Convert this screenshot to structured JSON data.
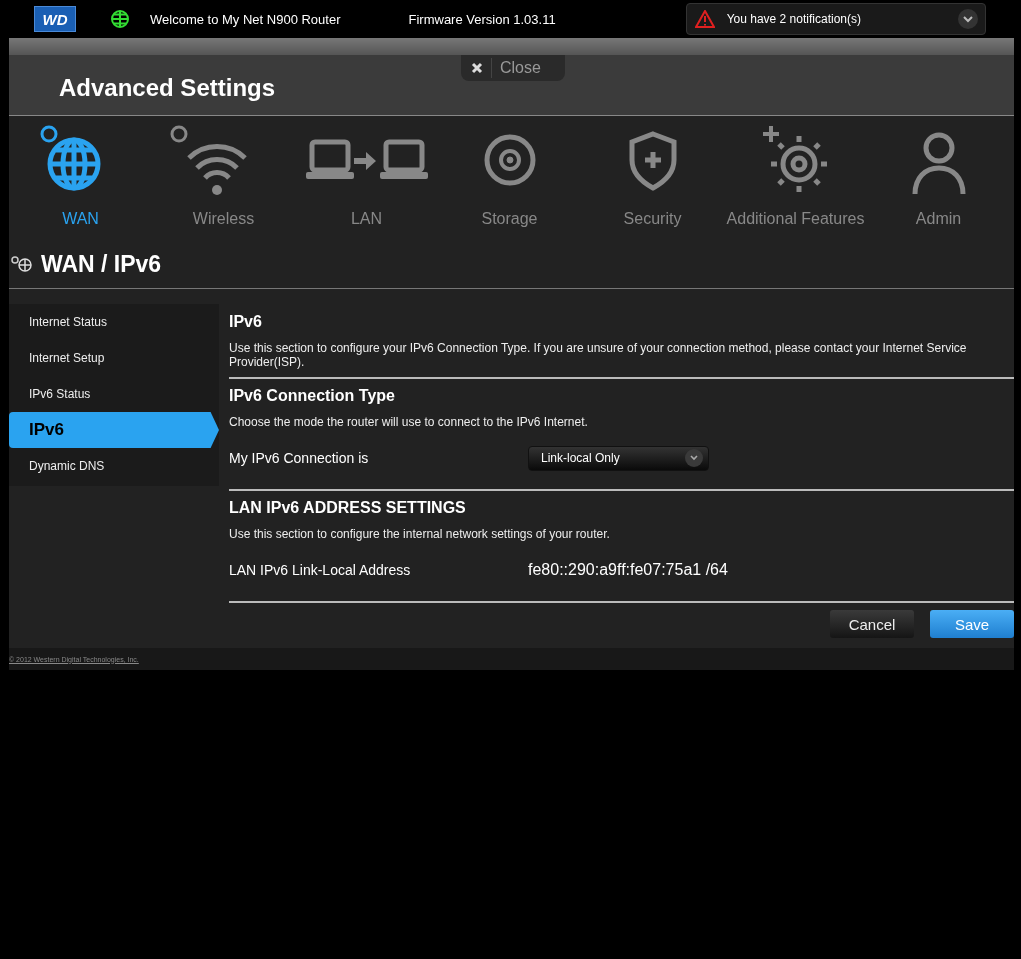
{
  "top_bar": {
    "logo": "WD",
    "welcome": "Welcome to My Net N900 Router",
    "firmware": "Firmware Version 1.03.11",
    "notification": "You have 2 notification(s)"
  },
  "close_tab": {
    "label": "Close"
  },
  "title": "Advanced Settings",
  "tabs": [
    {
      "label": "WAN",
      "selected": true
    },
    {
      "label": "Wireless",
      "selected": false
    },
    {
      "label": "LAN",
      "selected": false
    },
    {
      "label": "Storage",
      "selected": false
    },
    {
      "label": "Security",
      "selected": false
    },
    {
      "label": "Additional Features",
      "selected": false
    },
    {
      "label": "Admin",
      "selected": false
    }
  ],
  "section_heading": "WAN / IPv6",
  "sidebar": {
    "items": [
      {
        "label": "Internet Status",
        "selected": false
      },
      {
        "label": "Internet Setup",
        "selected": false
      },
      {
        "label": "IPv6 Status",
        "selected": false
      },
      {
        "label": "IPv6",
        "selected": true
      },
      {
        "label": "Dynamic DNS",
        "selected": false
      }
    ]
  },
  "sections": [
    {
      "heading": "IPv6",
      "description": "Use this section to configure your IPv6 Connection Type. If you are unsure of your connection method, please contact your Internet Service Provider(ISP)."
    },
    {
      "heading": "IPv6 Connection Type",
      "description": "Choose the mode the router will use to connect to the IPv6 Internet.",
      "field": {
        "kind": "select",
        "label": "My IPv6 Connection is",
        "value": "Link-local Only"
      }
    },
    {
      "heading": "LAN IPv6 ADDRESS SETTINGS",
      "description": "Use this section to configure the internal network settings of your router.",
      "field": {
        "kind": "text",
        "label": "LAN IPv6 Link-Local Address",
        "value": "fe80::290:a9ff:fe07:75a1 /64"
      }
    }
  ],
  "buttons": {
    "cancel": "Cancel",
    "save": "Save"
  },
  "footer": "© 2012 Western Digital Technologies, Inc."
}
